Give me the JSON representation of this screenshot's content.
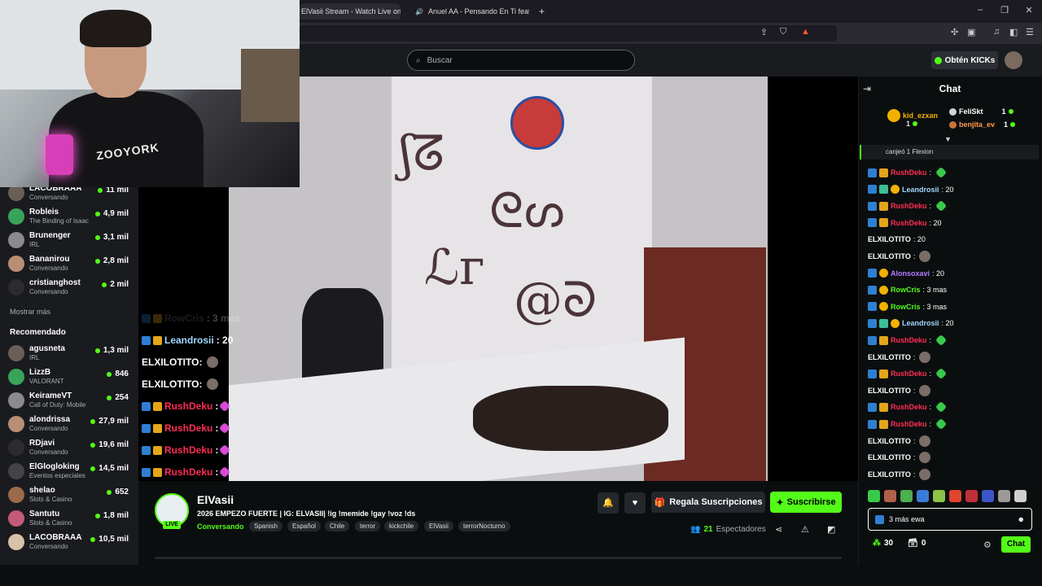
{
  "browser": {
    "tabs": [
      {
        "label": "ElVasii Stream - Watch Live on"
      },
      {
        "label": "Anuel AA - Pensando En Ti feat."
      }
    ],
    "new_tab_icon": "plus-icon"
  },
  "header": {
    "search_placeholder": "Buscar",
    "get_kicks_label": "Obtén KICKs"
  },
  "sidebar": {
    "following": [
      {
        "name": "LACOBRAAA",
        "category": "Conversando",
        "viewers": "11 mil"
      },
      {
        "name": "Robleis",
        "category": "The Binding of Isaac",
        "viewers": "4,9 mil"
      },
      {
        "name": "Brunenger",
        "category": "IRL",
        "viewers": "3,1 mil"
      },
      {
        "name": "Bananirou",
        "category": "Conversando",
        "viewers": "2,8 mil"
      },
      {
        "name": "cristianghost",
        "category": "Conversando",
        "viewers": "2 mil"
      }
    ],
    "show_more": "Mostrar más",
    "recommended_heading": "Recomendado",
    "recommended": [
      {
        "name": "agusneta",
        "category": "IRL",
        "viewers": "1,3 mil"
      },
      {
        "name": "LizzB",
        "category": "VALORANT",
        "viewers": "846"
      },
      {
        "name": "KeirameVT",
        "category": "Call of Duty: Mobile",
        "viewers": "254"
      },
      {
        "name": "alondrissa",
        "category": "Conversando",
        "viewers": "27,9 mil"
      },
      {
        "name": "RDjavi",
        "category": "Conversando",
        "viewers": "19,6 mil"
      },
      {
        "name": "ElGlogloking",
        "category": "Eventos especiales",
        "viewers": "14,5 mil"
      },
      {
        "name": "shelao",
        "category": "Slots & Casino",
        "viewers": "652"
      },
      {
        "name": "Santutu",
        "category": "Slots & Casino",
        "viewers": "1,8 mil"
      },
      {
        "name": "LACOBRAAA",
        "category": "Conversando",
        "viewers": "10,5 mil"
      }
    ]
  },
  "webcam": {
    "shirt_text": "ZOOYORK"
  },
  "video_overlay_chat": [
    {
      "user": "RowCris",
      "text": ": 3 mas",
      "color": "#6b6b6b"
    },
    {
      "user": "Leandrosii",
      "text": ": 20",
      "color": "#9fd8ff"
    },
    {
      "user": "ELXILOTITO:",
      "text": "",
      "color": "#ffffff"
    },
    {
      "user": "ELXILOTITO:",
      "text": "",
      "color": "#ffffff"
    },
    {
      "user": "RushDeku",
      "text": ":",
      "color": "#ff2d55"
    },
    {
      "user": "RushDeku",
      "text": ":",
      "color": "#ff2d55"
    },
    {
      "user": "RushDeku",
      "text": ":",
      "color": "#ff2d55"
    },
    {
      "user": "RushDeku",
      "text": ":",
      "color": "#ff2d55"
    }
  ],
  "stream": {
    "streamer": "ElVasii",
    "live_label": "LIVE",
    "title": "2026 EMPEZO FUERTE | IG: ELVASII| !ig !memide !gay !voz !ds",
    "category": "Conversando",
    "tags": [
      "Spanish",
      "Español",
      "Chile",
      "terror",
      "kickchile",
      "ElVasii",
      "terrorNocturno"
    ],
    "gift_subs_label": "Regala Suscripciones",
    "subscribe_label": "Suscribirse",
    "viewer_count": "21",
    "viewer_label": "Espectadores"
  },
  "chat": {
    "title": "Chat",
    "top_gifters": [
      {
        "name": "kid_ezxan",
        "count": "1"
      },
      {
        "name": "FeliSkt",
        "count": "1"
      },
      {
        "name": "benjita_ev",
        "count": "1"
      }
    ],
    "pinned_text": "canjeó 1 Flexion",
    "messages": [
      {
        "user": "RushDeku",
        "text": ":",
        "color": "#ff2d55",
        "badges": [
          "blue",
          "gold"
        ],
        "emote": "green"
      },
      {
        "user": "Leandrosii",
        "text": ": 20",
        "color": "#9fd8ff",
        "badges": [
          "blue",
          "sub",
          "circ"
        ],
        "emote": ""
      },
      {
        "user": "RushDeku",
        "text": ":",
        "color": "#ff2d55",
        "badges": [
          "blue",
          "gold"
        ],
        "emote": "green"
      },
      {
        "user": "RushDeku",
        "text": ": 20",
        "color": "#ff2d55",
        "badges": [
          "blue",
          "gold"
        ],
        "emote": ""
      },
      {
        "user": "ELXILOTITO",
        "text": ": 20",
        "color": "#ffffff",
        "badges": [],
        "emote": ""
      },
      {
        "user": "ELXILOTITO",
        "text": ":",
        "color": "#ffffff",
        "badges": [],
        "emote": "face"
      },
      {
        "user": "Alonsoxavi",
        "text": ": 20",
        "color": "#b57bff",
        "badges": [
          "blue",
          "circ"
        ],
        "emote": ""
      },
      {
        "user": "RowCris",
        "text": ": 3 mas",
        "color": "#53fc18",
        "badges": [
          "blue",
          "circ"
        ],
        "emote": ""
      },
      {
        "user": "RowCris",
        "text": ": 3 mas",
        "color": "#53fc18",
        "badges": [
          "blue",
          "circ"
        ],
        "emote": ""
      },
      {
        "user": "Leandrosii",
        "text": ": 20",
        "color": "#9fd8ff",
        "badges": [
          "blue",
          "sub",
          "circ"
        ],
        "emote": ""
      },
      {
        "user": "RushDeku",
        "text": ":",
        "color": "#ff2d55",
        "badges": [
          "blue",
          "gold"
        ],
        "emote": "green"
      },
      {
        "user": "ELXILOTITO",
        "text": ":",
        "color": "#ffffff",
        "badges": [],
        "emote": "face"
      },
      {
        "user": "RushDeku",
        "text": ":",
        "color": "#ff2d55",
        "badges": [
          "blue",
          "gold"
        ],
        "emote": "green"
      },
      {
        "user": "ELXILOTITO",
        "text": ":",
        "color": "#ffffff",
        "badges": [],
        "emote": "face"
      },
      {
        "user": "RushDeku",
        "text": ":",
        "color": "#ff2d55",
        "badges": [
          "blue",
          "gold"
        ],
        "emote": "green"
      },
      {
        "user": "RushDeku",
        "text": ":",
        "color": "#ff2d55",
        "badges": [
          "blue",
          "gold"
        ],
        "emote": "green"
      },
      {
        "user": "ELXILOTITO",
        "text": ":",
        "color": "#ffffff",
        "badges": [],
        "emote": "face"
      },
      {
        "user": "ELXILOTITO",
        "text": ":",
        "color": "#ffffff",
        "badges": [],
        "emote": "face"
      },
      {
        "user": "ELXILOTITO",
        "text": ":",
        "color": "#ffffff",
        "badges": [],
        "emote": "face"
      }
    ],
    "input_value": "3 más ewa",
    "points": "30",
    "gift_count": "0",
    "send_label": "Chat"
  },
  "colors": {
    "accent": "#53fc18",
    "background": "#0b0e0f",
    "panel": "#191b1f"
  }
}
